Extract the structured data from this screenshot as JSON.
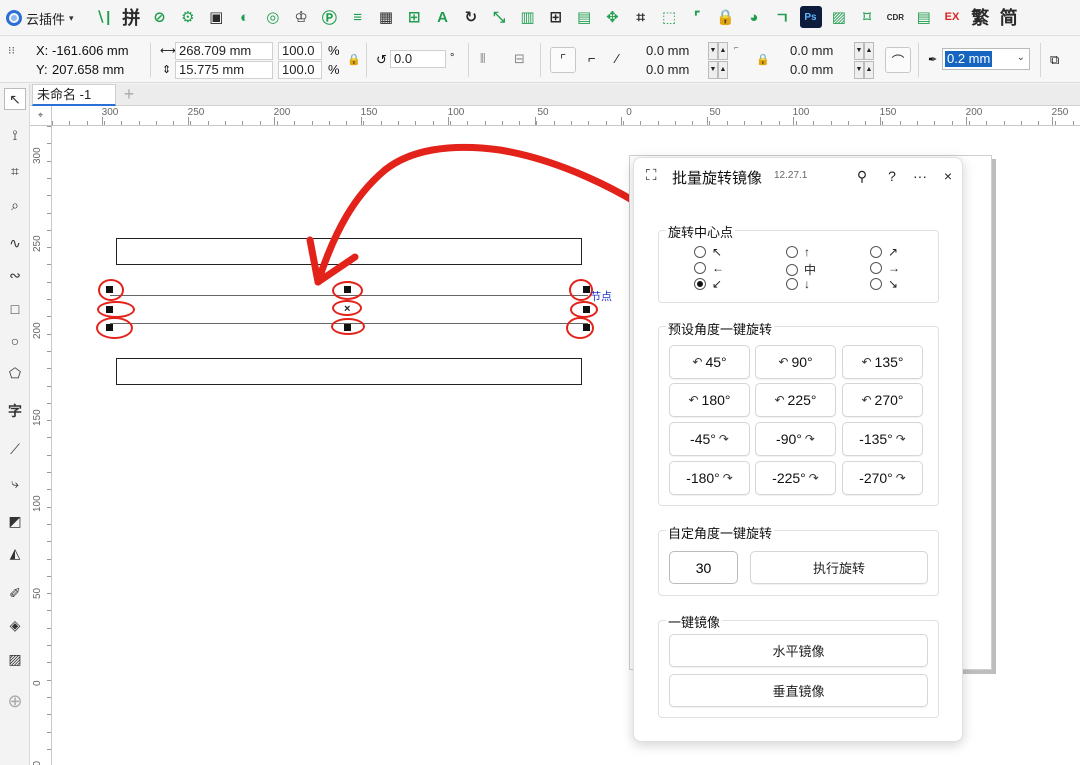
{
  "toolbar": {
    "plugin_label": "云插件",
    "plugin_caret": "▾",
    "icons": [
      {
        "name": "sequence-icon",
        "glyph": "∖|"
      },
      {
        "name": "merge-icon",
        "glyph": "拼"
      },
      {
        "name": "crop-edit-icon",
        "glyph": "⊘"
      },
      {
        "name": "node-icon",
        "glyph": "⚙"
      },
      {
        "name": "image-icon",
        "glyph": "▣"
      },
      {
        "name": "copy-icon",
        "glyph": "◐"
      },
      {
        "name": "rotate-copy-icon",
        "glyph": "◎"
      },
      {
        "name": "stamp-icon",
        "glyph": "♔"
      },
      {
        "name": "badge-icon",
        "glyph": "Ⓟ"
      },
      {
        "name": "lines-icon",
        "glyph": "≡"
      },
      {
        "name": "layers-icon",
        "glyph": "▦"
      },
      {
        "name": "add-page-icon",
        "glyph": "⊞"
      },
      {
        "name": "text-box-icon",
        "glyph": "A"
      },
      {
        "name": "refresh-icon",
        "glyph": "↻"
      },
      {
        "name": "resize-icon",
        "glyph": "⤡"
      },
      {
        "name": "chart-icon",
        "glyph": "▥"
      },
      {
        "name": "grid-icon",
        "glyph": "⊞"
      },
      {
        "name": "window-icon",
        "glyph": "▤"
      },
      {
        "name": "move-icon",
        "glyph": "✥"
      },
      {
        "name": "select-box-icon",
        "glyph": "⌗"
      },
      {
        "name": "dashed-box-icon",
        "glyph": "⬚"
      },
      {
        "name": "crop-icon",
        "glyph": "⌜"
      },
      {
        "name": "lock-icon",
        "glyph": "🔒"
      },
      {
        "name": "color-wheel-icon",
        "glyph": "◕"
      },
      {
        "name": "corner-icon",
        "glyph": "ㄱ"
      },
      {
        "name": "photoshop-icon",
        "glyph": "Ps"
      },
      {
        "name": "picture-icon",
        "glyph": "▨"
      },
      {
        "name": "frame-icon",
        "glyph": "⌑"
      },
      {
        "name": "cdr-icon",
        "glyph": "CDR"
      },
      {
        "name": "table-icon",
        "glyph": "▤"
      },
      {
        "name": "ex-icon",
        "glyph": "EX"
      },
      {
        "name": "traditional-icon",
        "glyph": "繁"
      },
      {
        "name": "simplified-icon",
        "glyph": "简"
      }
    ]
  },
  "property_bar": {
    "x_label": "X:",
    "x_value": "-161.606 mm",
    "y_label": "Y:",
    "y_value": "207.658 mm",
    "w_value": "268.709 mm",
    "h_value": "15.775 mm",
    "scale_x": "100.0",
    "scale_y": "100.0",
    "percent": "%",
    "rotation": "0.0",
    "degree": "°",
    "corner_a": "0.0 mm",
    "corner_b": "0.0 mm",
    "corner_c": "0.0 mm",
    "corner_d": "0.0 mm",
    "outline_width": "0.2 mm"
  },
  "document": {
    "tab_label": "未命名 -1",
    "add_tab": "+"
  },
  "rulers": {
    "horizontal": [
      "300",
      "250",
      "200",
      "150",
      "100",
      "50",
      "0",
      "50",
      "100",
      "150",
      "200",
      "250"
    ],
    "vertical": [
      "300",
      "250",
      "200",
      "150",
      "100",
      "50",
      "0",
      "50"
    ],
    "unit": "毫米"
  },
  "canvas": {
    "node_label": "节点"
  },
  "panel": {
    "title": "批量旋转镜像",
    "version": "12.27.1",
    "pin": "⚲",
    "help": "?",
    "more": "···",
    "close": "×",
    "center_group_title": "旋转中心点",
    "center_options": [
      {
        "glyph": "↖",
        "selected": false
      },
      {
        "glyph": "↑",
        "selected": false
      },
      {
        "glyph": "↗",
        "selected": false
      },
      {
        "glyph": "←",
        "selected": false
      },
      {
        "glyph": "中",
        "selected": false
      },
      {
        "glyph": "→",
        "selected": false
      },
      {
        "glyph": "↙",
        "selected": true
      },
      {
        "glyph": "↓",
        "selected": false
      },
      {
        "glyph": "↘",
        "selected": false
      }
    ],
    "preset_group_title": "预设角度一键旋转",
    "preset_buttons": [
      {
        "label": "45°",
        "icon": "↶",
        "icon_first": true
      },
      {
        "label": "90°",
        "icon": "↶",
        "icon_first": true
      },
      {
        "label": "135°",
        "icon": "↶",
        "icon_first": true
      },
      {
        "label": "180°",
        "icon": "↶",
        "icon_first": true
      },
      {
        "label": "225°",
        "icon": "↶",
        "icon_first": true
      },
      {
        "label": "270°",
        "icon": "↶",
        "icon_first": true
      },
      {
        "label": "-45°",
        "icon": "↷",
        "icon_first": false
      },
      {
        "label": "-90°",
        "icon": "↷",
        "icon_first": false
      },
      {
        "label": "-135°",
        "icon": "↷",
        "icon_first": false
      },
      {
        "label": "-180°",
        "icon": "↷",
        "icon_first": false
      },
      {
        "label": "-225°",
        "icon": "↷",
        "icon_first": false
      },
      {
        "label": "-270°",
        "icon": "↷",
        "icon_first": false
      }
    ],
    "custom_group_title": "自定角度一键旋转",
    "custom_angle": "30",
    "execute_label": "执行旋转",
    "mirror_group_title": "一键镜像",
    "mirror_horizontal": "水平镜像",
    "mirror_vertical": "垂直镜像"
  },
  "colors": {
    "annotation_red": "#e3221a",
    "accent_blue": "#2a6fd6",
    "selection_highlight": "#1565c0"
  }
}
